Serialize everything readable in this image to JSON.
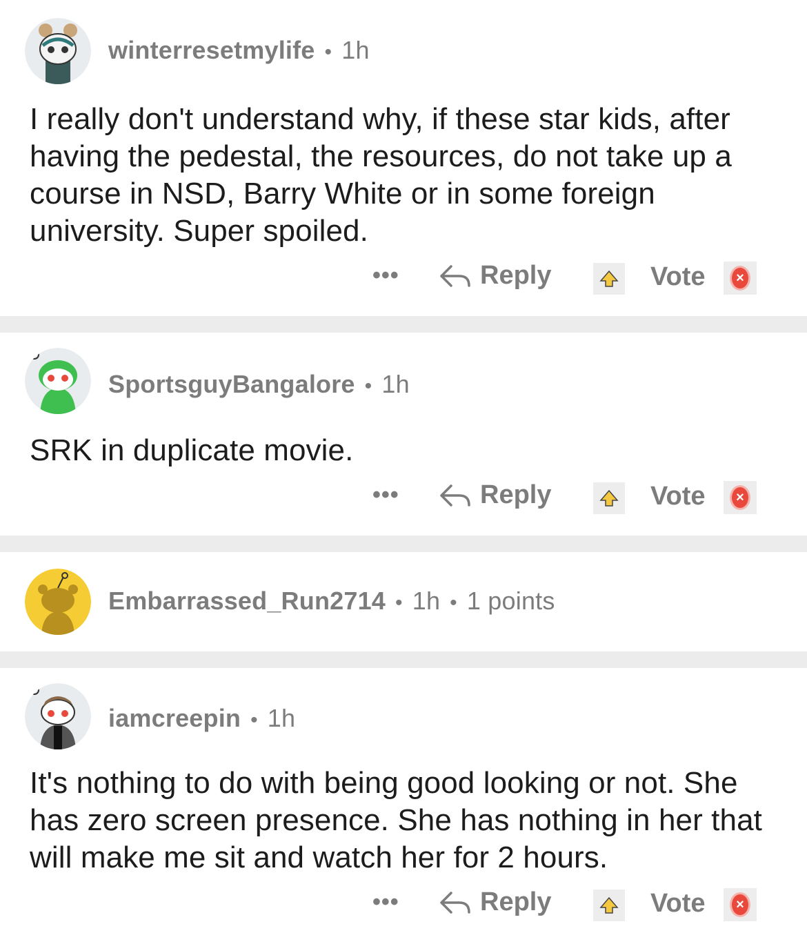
{
  "comments": [
    {
      "username": "winterresetmylife",
      "time": "1h",
      "body": "I really don't understand why, if these star kids, after having the pedestal, the resources, do not take up a course in NSD, Barry White or in some foreign university. Super spoiled.",
      "more": "•••",
      "reply": "Reply",
      "vote": "Vote"
    },
    {
      "username": "SportsguyBangalore",
      "time": "1h",
      "body": "SRK in duplicate movie.",
      "more": "•••",
      "reply": "Reply",
      "vote": "Vote"
    },
    {
      "username": "Embarrassed_Run2714",
      "time": "1h",
      "points": "1 points"
    },
    {
      "username": "iamcreepin",
      "time": "1h",
      "body": "It's nothing to do with being good looking or not. She has zero screen presence. She has nothing in her that will make me sit and watch her for 2 hours.",
      "more": "•••",
      "reply": "Reply",
      "vote": "Vote"
    }
  ],
  "colors": {
    "meta": "#7c7c7c",
    "separator": "#ececec",
    "downvote": "#e8493c",
    "upvote": "#f5c842"
  }
}
